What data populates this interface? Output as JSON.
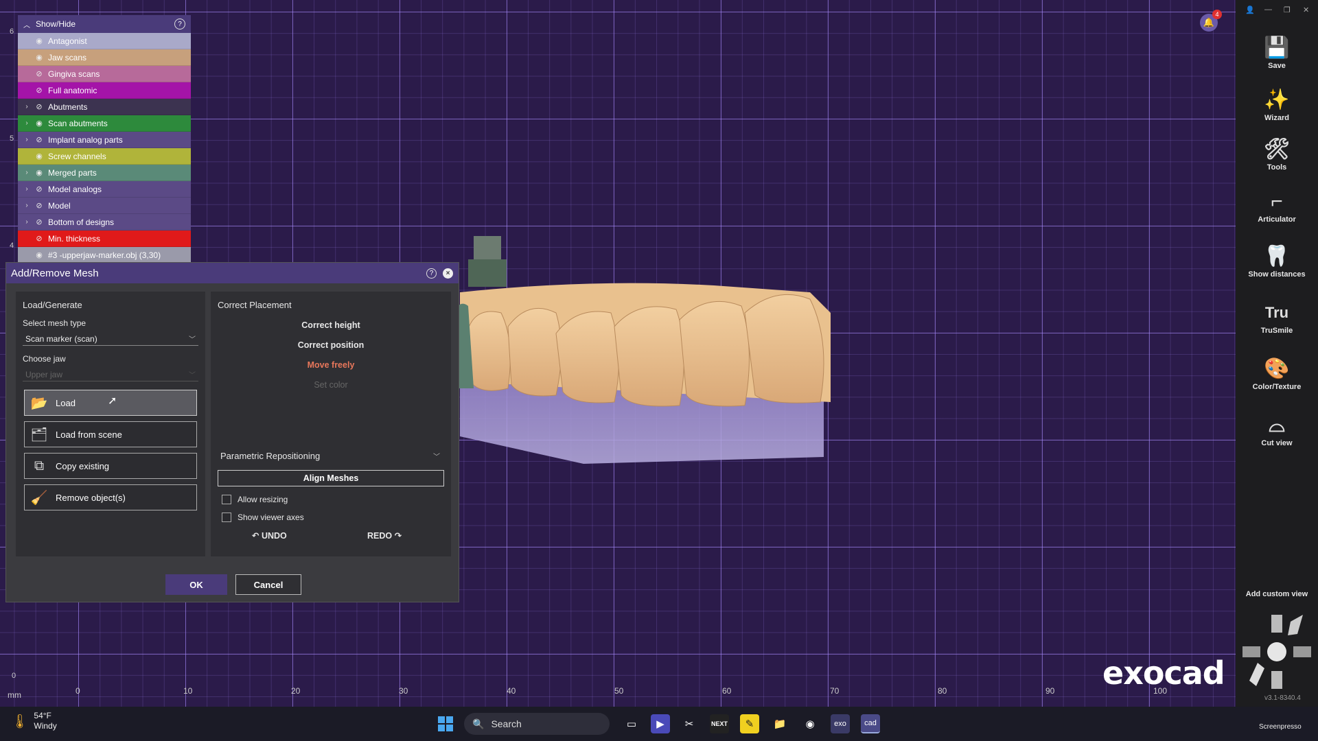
{
  "show_hide": {
    "title": "Show/Hide",
    "items": [
      {
        "label": "Antagonist",
        "color": "#a9a9c9",
        "expandable": false,
        "visible": true
      },
      {
        "label": "Jaw scans",
        "color": "#c7a07c",
        "expandable": false,
        "visible": true
      },
      {
        "label": "Gingiva scans",
        "color": "#b76a9a",
        "expandable": false,
        "visible": false
      },
      {
        "label": "Full anatomic",
        "color": "#a414a8",
        "expandable": false,
        "visible": false
      },
      {
        "label": "Abutments",
        "color": "#3c3350",
        "expandable": true,
        "visible": false
      },
      {
        "label": "Scan abutments",
        "color": "#2d8a3c",
        "expandable": true,
        "visible": true
      },
      {
        "label": "Implant analog parts",
        "color": "#5b4a86",
        "expandable": true,
        "visible": false
      },
      {
        "label": "Screw channels",
        "color": "#b0b43a",
        "expandable": false,
        "visible": true
      },
      {
        "label": "Merged parts",
        "color": "#5a8a78",
        "expandable": true,
        "visible": true
      },
      {
        "label": "Model analogs",
        "color": "#5b4a86",
        "expandable": true,
        "visible": false
      },
      {
        "label": "Model",
        "color": "#5b4a86",
        "expandable": true,
        "visible": false
      },
      {
        "label": "Bottom of designs",
        "color": "#5b4a86",
        "expandable": true,
        "visible": false
      },
      {
        "label": "Min. thickness",
        "color": "#e01a1a",
        "expandable": false,
        "visible": false
      },
      {
        "label": "#3 -upperjaw-marker.obj (3,30)",
        "color": "#9a9aaa",
        "expandable": false,
        "visible": true
      }
    ]
  },
  "dialog": {
    "title": "Add/Remove Mesh",
    "left": {
      "section": "Load/Generate",
      "mesh_type_label": "Select mesh type",
      "mesh_type_value": "Scan marker (scan)",
      "jaw_label": "Choose jaw",
      "jaw_value": "Upper jaw",
      "buttons": {
        "load": "Load",
        "load_from_scene": "Load from scene",
        "copy_existing": "Copy existing",
        "remove_objects": "Remove object(s)"
      }
    },
    "right": {
      "section": "Correct Placement",
      "correct_height": "Correct height",
      "correct_position": "Correct position",
      "move_freely": "Move freely",
      "set_color": "Set color",
      "parametric": "Parametric Repositioning",
      "align_meshes": "Align Meshes",
      "allow_resizing": "Allow resizing",
      "show_viewer_axes": "Show viewer axes",
      "undo": "UNDO",
      "redo": "REDO"
    },
    "ok": "OK",
    "cancel": "Cancel"
  },
  "ruler": {
    "unit": "mm",
    "x_ticks": [
      "0",
      "10",
      "20",
      "30",
      "40",
      "50",
      "60",
      "70",
      "80",
      "90",
      "100"
    ],
    "y_ticks": [
      "6",
      "5",
      "4"
    ],
    "y_zero": "0"
  },
  "toolbar": {
    "items": [
      {
        "label": "Save",
        "icon": "save-icon",
        "glyph": "💾"
      },
      {
        "label": "Wizard",
        "icon": "wizard-icon",
        "glyph": "✨"
      },
      {
        "label": "Tools",
        "icon": "tools-icon",
        "glyph": "🛠"
      },
      {
        "label": "Articulator",
        "icon": "articulator-icon",
        "glyph": "⌐"
      },
      {
        "label": "Show distances",
        "icon": "show-distances-icon",
        "glyph": "🦷"
      },
      {
        "label": "TruSmile",
        "icon": "trusmile-icon",
        "glyph": "Tru"
      },
      {
        "label": "Color/Texture",
        "icon": "color-texture-icon",
        "glyph": "🎨"
      },
      {
        "label": "Cut view",
        "icon": "cut-view-icon",
        "glyph": "⌓"
      }
    ],
    "add_custom_view": "Add custom view",
    "version": "v3.1-8340.4"
  },
  "notifications": {
    "count": "4"
  },
  "brand": "exocad",
  "taskbar": {
    "temperature": "54°F",
    "condition": "Windy",
    "search_placeholder": "Search",
    "next_label": "NEXT",
    "exo_label": "exo",
    "cad_label": "cad",
    "screenpresso": "Screenpresso"
  }
}
